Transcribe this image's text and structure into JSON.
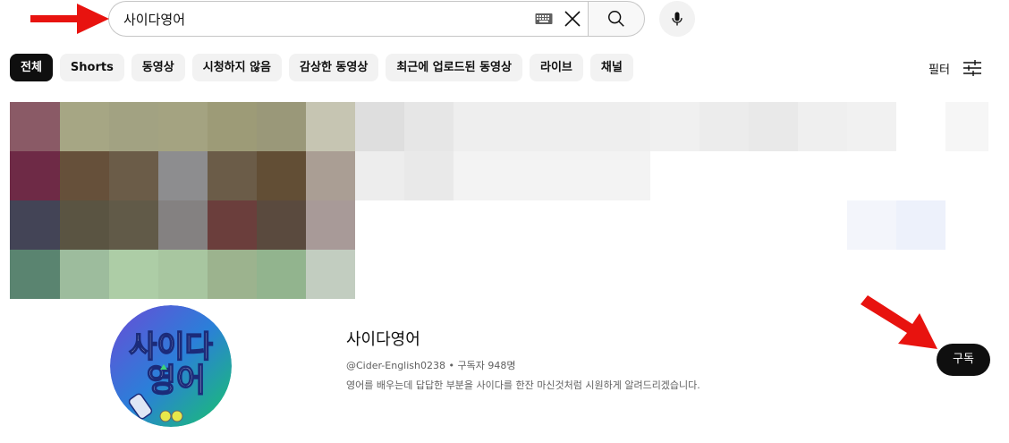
{
  "search": {
    "value": "사이다영어",
    "keyboard_icon": "keyboard-icon",
    "clear_icon": "close-icon",
    "search_icon": "search-icon",
    "mic_icon": "microphone-icon"
  },
  "chips": [
    {
      "label": "전체",
      "active": true
    },
    {
      "label": "Shorts",
      "active": false
    },
    {
      "label": "동영상",
      "active": false
    },
    {
      "label": "시청하지 않음",
      "active": false
    },
    {
      "label": "감상한 동영상",
      "active": false
    },
    {
      "label": "최근에 업로드된 동영상",
      "active": false
    },
    {
      "label": "라이브",
      "active": false
    },
    {
      "label": "채널",
      "active": false
    }
  ],
  "filter": {
    "label": "필터",
    "icon": "sliders-icon"
  },
  "channel": {
    "name": "사이다영어",
    "handle_and_subs": "@Cider-English0238 • 구독자 948명",
    "description": "영어를 배우는데 답답한 부분을 사이다를 한잔 마신것처럼 시원하게 알려드리겠습니다.",
    "avatar_text_line1": "사이다",
    "avatar_text_line2": "영어",
    "subscribe_label": "구독"
  },
  "colors": {
    "annotation_arrow": "#e8130f",
    "chip_active_bg": "#0f0f0f",
    "chip_bg": "#f2f2f2"
  }
}
